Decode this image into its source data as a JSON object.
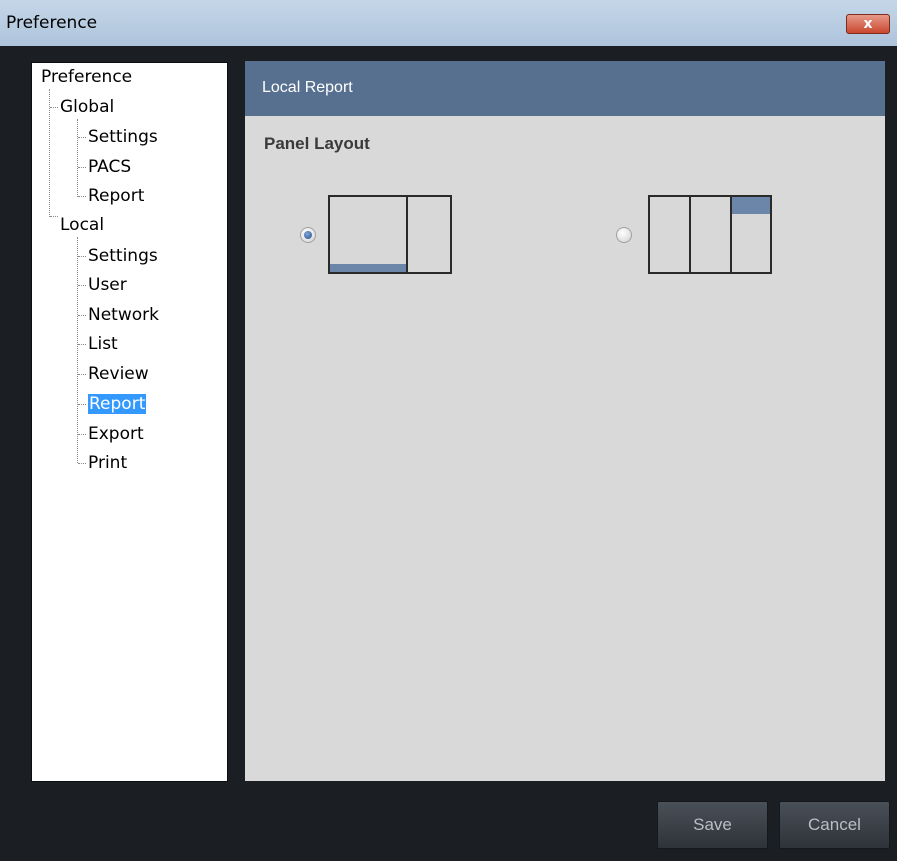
{
  "window": {
    "title": "Preference",
    "close_label": "x"
  },
  "tree": {
    "root": "Preference",
    "global": {
      "label": "Global",
      "children": [
        "Settings",
        "PACS",
        "Report"
      ]
    },
    "local": {
      "label": "Local",
      "children": [
        "Settings",
        "User",
        "Network",
        "List",
        "Review",
        "Report",
        "Export",
        "Print"
      ]
    },
    "selected": "Local/Report"
  },
  "panel": {
    "title": "Local Report",
    "section_label": "Panel Layout",
    "layout_options": [
      {
        "id": "layout-1",
        "selected": true
      },
      {
        "id": "layout-2",
        "selected": false
      }
    ]
  },
  "buttons": {
    "save": "Save",
    "cancel": "Cancel"
  },
  "colors": {
    "header": "#58708f",
    "selection": "#3399ff",
    "panel_bg": "#d9d9d9",
    "frame_bg": "#1b1f24"
  }
}
